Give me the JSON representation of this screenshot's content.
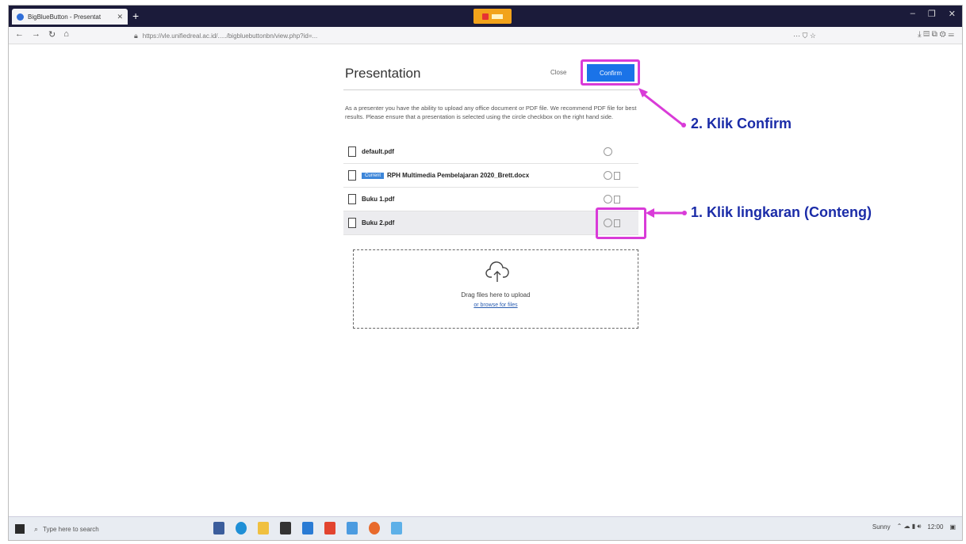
{
  "browser": {
    "tab_title": "BigBlueButton - Presentat",
    "new_tab": "+",
    "window_controls": [
      "–",
      "❐",
      "✕"
    ],
    "nav_buttons": [
      "←",
      "→",
      "↻",
      "⌂"
    ],
    "url": "https://vle.unifiedreal.ac.id/...../bigbluebuttonbn/view.php?id=...",
    "url_right": "⋯  ⛉  ☆",
    "toolbar_icons": "⤓  ▤  ⧉  ⚙  ☰"
  },
  "panel": {
    "title": "Presentation",
    "cancel_label": "Close",
    "confirm_label": "Confirm",
    "description": "As a presenter you have the ability to upload any office document or PDF file. We recommend PDF file for best results. Please ensure that a presentation is selected using the circle checkbox on the right hand side.",
    "files": [
      {
        "name": "default.pdf",
        "badge": ""
      },
      {
        "name": "RPH Multimedia Pembelajaran 2020_Brett.docx",
        "badge": "Current"
      },
      {
        "name": "Buku 1.pdf",
        "badge": ""
      },
      {
        "name": "Buku 2.pdf",
        "badge": ""
      }
    ],
    "drop_text": "Drag files here to upload",
    "browse_text": "or browse for files"
  },
  "annotations": {
    "step2": "2. Klik Confirm",
    "step1": "1. Klik lingkaran (Conteng)",
    "color": "#d93bd8",
    "text_color": "#1b2ca8"
  },
  "taskbar": {
    "search_placeholder": "Type here to search",
    "tray_text": "Sunny",
    "clock": "12:00"
  }
}
